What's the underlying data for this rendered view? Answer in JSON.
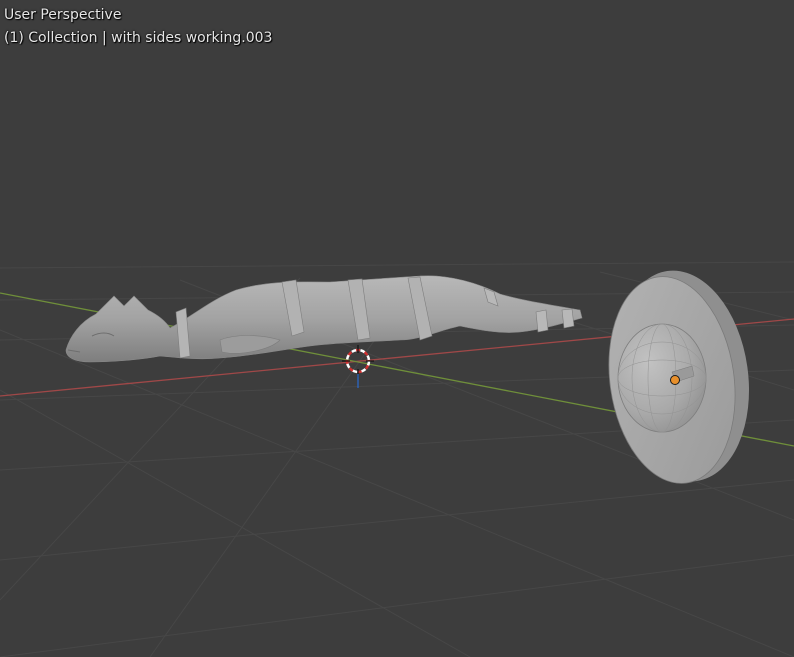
{
  "viewport": {
    "view_name": "User Perspective",
    "collection_info": "(1) Collection | with sides working.003",
    "background_color": "#3d3d3d",
    "grid_color": "#474747",
    "x_axis_color": "#a04848",
    "y_axis_color": "#6f8f3a"
  },
  "objects": [
    {
      "name": "cat-sculpture-mesh",
      "color": "#a3a3a3"
    },
    {
      "name": "disc-with-dome-mesh",
      "color": "#a8a8a8"
    }
  ],
  "cursor": {
    "name": "3d-cursor"
  },
  "origin_point": {
    "color": "#e8902c"
  }
}
